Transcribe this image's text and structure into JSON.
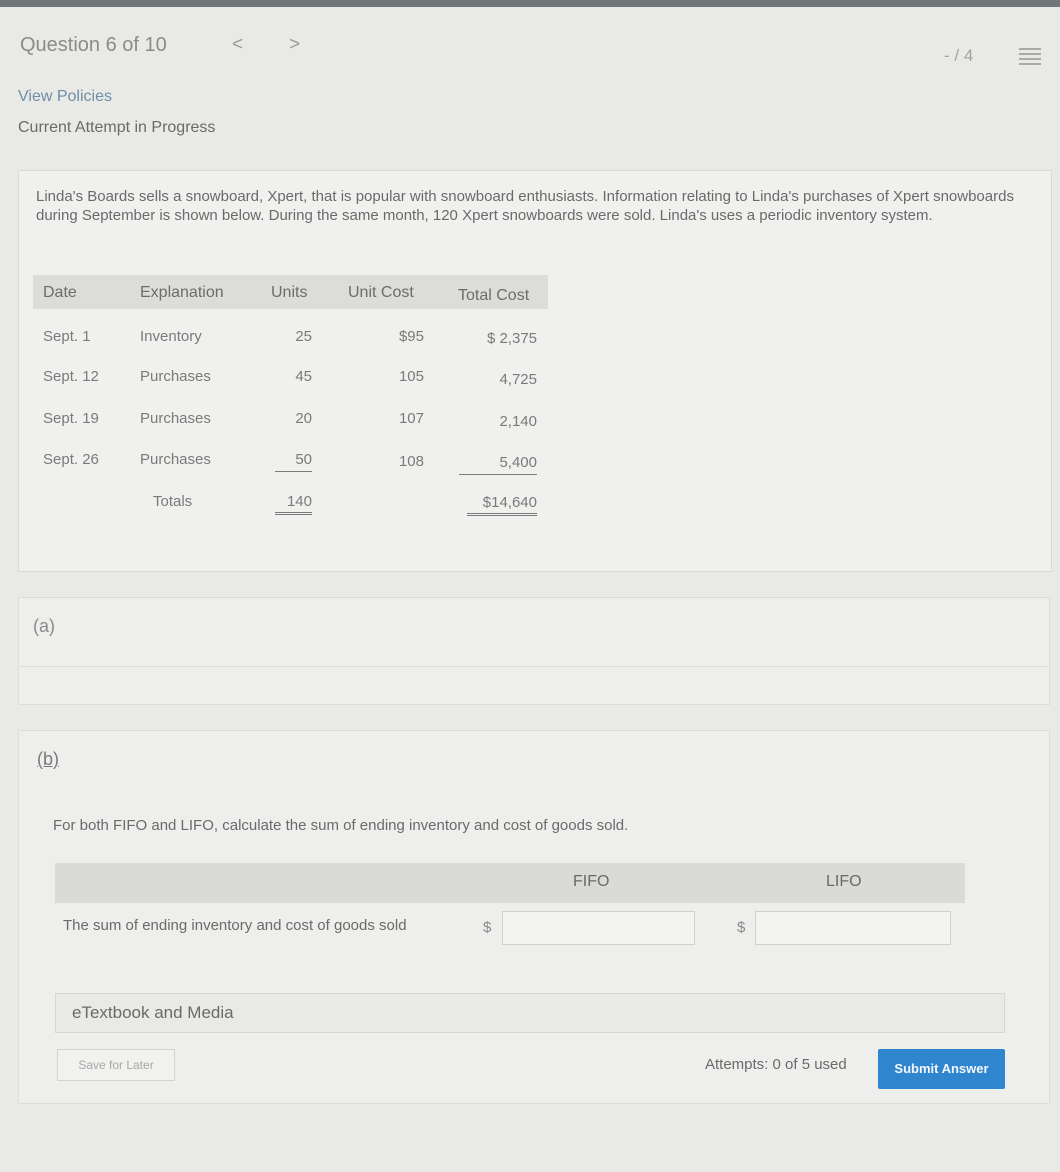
{
  "header": {
    "question_label": "Question 6 of 10",
    "prev_glyph": "<",
    "next_glyph": ">",
    "score": "- / 4",
    "menu_icon": "list-icon"
  },
  "links": {
    "view_policies": "View Policies",
    "attempt_status": "Current Attempt in Progress"
  },
  "problem": {
    "text": "Linda's Boards sells a snowboard, Xpert, that is popular with snowboard enthusiasts. Information relating to Linda's purchases of Xpert snowboards during September is shown below. During the same month, 120 Xpert snowboards were sold. Linda's uses a periodic inventory system.",
    "table": {
      "headers": [
        "Date",
        "Explanation",
        "Units",
        "Unit Cost",
        "Total Cost"
      ],
      "rows": [
        [
          "Sept. 1",
          "Inventory",
          "25",
          "$95",
          "$ 2,375"
        ],
        [
          "Sept. 12",
          "Purchases",
          "45",
          "105",
          "4,725"
        ],
        [
          "Sept. 19",
          "Purchases",
          "20",
          "107",
          "2,140"
        ],
        [
          "Sept. 26",
          "Purchases",
          "50",
          "108",
          "5,400"
        ]
      ],
      "totals": {
        "label": "Totals",
        "units": "140",
        "total_cost": "$14,640"
      }
    }
  },
  "part_a": {
    "label": "(a)"
  },
  "part_b": {
    "label": "(b)",
    "instruction": "For both FIFO and LIFO, calculate the sum of ending inventory and cost of goods sold.",
    "col_fifo": "FIFO",
    "col_lifo": "LIFO",
    "row_label": "The sum of ending inventory and cost of goods sold",
    "currency": "$",
    "fifo_value": "",
    "lifo_value": ""
  },
  "footer": {
    "etextbook": "eTextbook and Media",
    "save_later": "Save for Later",
    "attempts": "Attempts: 0 of 5 used",
    "submit": "Submit Answer"
  },
  "colors": {
    "submit_bg": "#2f86cf",
    "link": "#6f8ea8"
  }
}
